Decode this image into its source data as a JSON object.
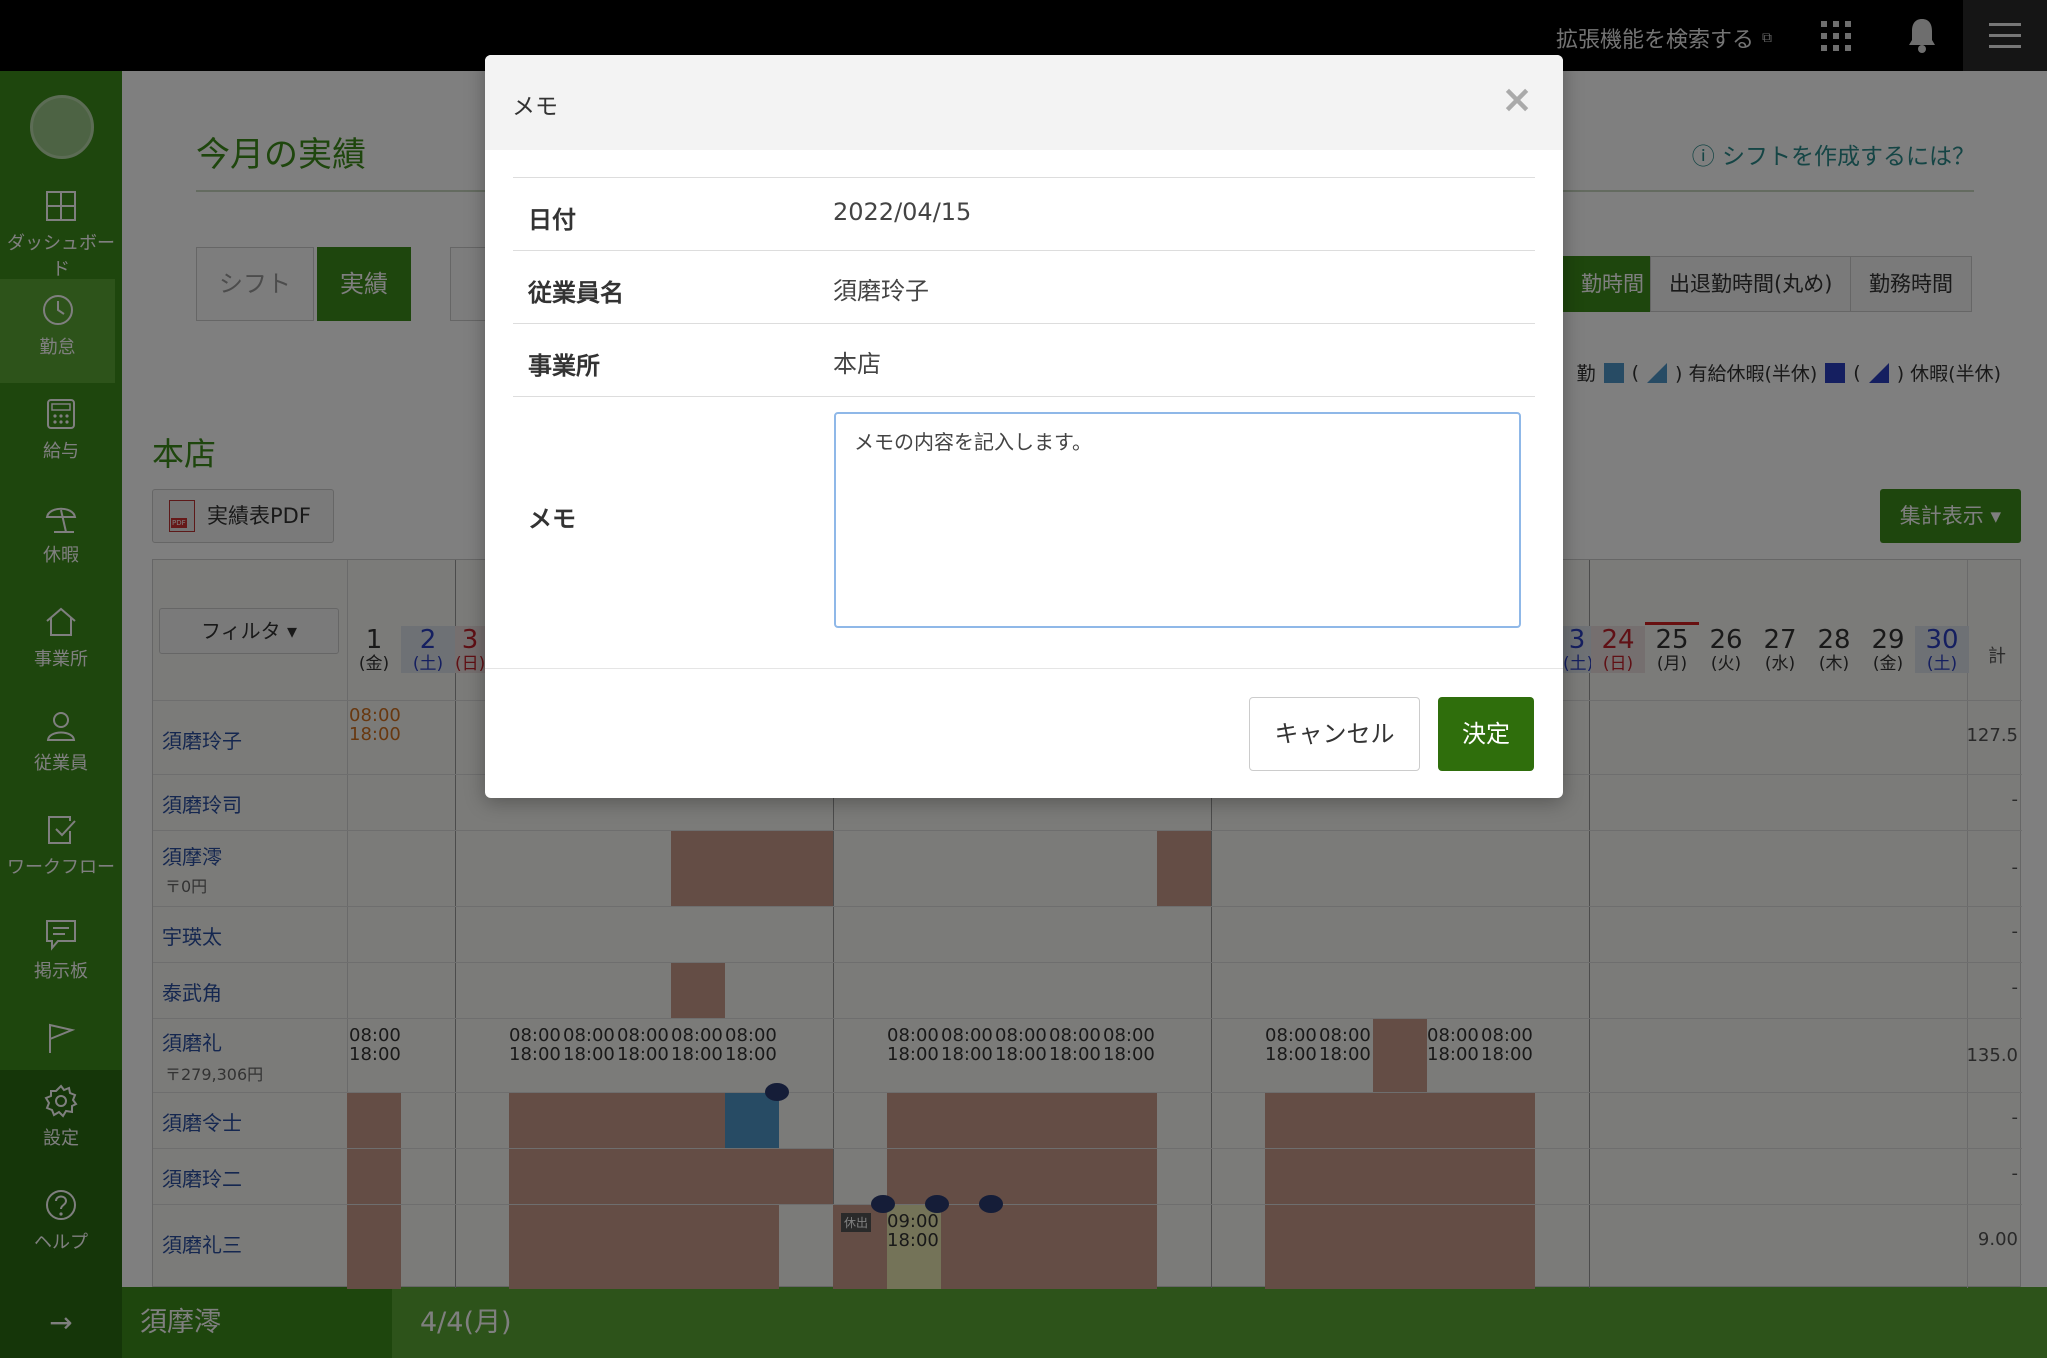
{
  "topbar": {
    "ext_search_label": "拡張機能を検索する",
    "ext_icon": "external-link-icon",
    "apps_icon": "apps-grid-icon",
    "bell_icon": "bell-icon",
    "menu_icon": "hamburger-icon"
  },
  "sidebar": {
    "items": [
      {
        "label": "ダッシュボード",
        "icon": "dashboard-icon"
      },
      {
        "label": "勤怠",
        "icon": "clock-icon"
      },
      {
        "label": "給与",
        "icon": "calculator-icon"
      },
      {
        "label": "休暇",
        "icon": "parasol-icon"
      },
      {
        "label": "事業所",
        "icon": "home-icon"
      },
      {
        "label": "従業員",
        "icon": "person-icon"
      },
      {
        "label": "ワークフロー",
        "icon": "workflow-icon"
      },
      {
        "label": "掲示板",
        "icon": "board-icon"
      },
      {
        "label": "",
        "icon": "flag-icon"
      },
      {
        "label": "設定",
        "icon": "gear-icon"
      },
      {
        "label": "ヘルプ",
        "icon": "help-icon"
      }
    ]
  },
  "bottombar": {
    "arrow": "→",
    "employee": "須摩澪",
    "date": "4/4(月)"
  },
  "main": {
    "title": "今月の実績",
    "help_link": "シフトを作成するには？",
    "tabs": [
      {
        "label": "シフト",
        "active": false
      },
      {
        "label": "実績",
        "active": true
      }
    ],
    "time_tabs": [
      {
        "label": "勤時間",
        "active": true
      },
      {
        "label": "出退勤時間(丸め)",
        "active": false
      },
      {
        "label": "勤務時間",
        "active": false
      }
    ],
    "legend": {
      "l0": "勤",
      "l1": "(",
      "l2": ") 有給休暇(半休)",
      "l3": "(",
      "l4": ") 休暇(半休)"
    },
    "store": "本店",
    "pdf_button": "実績表PDF",
    "agg_button": "集計表示 ▾",
    "filter_button": "フィルタ ▾",
    "total_header": "計",
    "days": [
      {
        "d": "1",
        "w": "(金)",
        "t": "w"
      },
      {
        "d": "2",
        "w": "(土)",
        "t": "sat"
      },
      {
        "d": "3",
        "w": "(日)",
        "t": "sun"
      },
      {
        "d": "3",
        "w": "(土)",
        "t": "sat"
      },
      {
        "d": "24",
        "w": "(日)",
        "t": "sun"
      },
      {
        "d": "25",
        "w": "(月)",
        "t": "w"
      },
      {
        "d": "26",
        "w": "(火)",
        "t": "w"
      },
      {
        "d": "27",
        "w": "(水)",
        "t": "w"
      },
      {
        "d": "28",
        "w": "(木)",
        "t": "w"
      },
      {
        "d": "29",
        "w": "(金)",
        "t": "w"
      },
      {
        "d": "30",
        "w": "(土)",
        "t": "sat"
      }
    ],
    "employees": [
      {
        "name": "須磨玲子",
        "sub": "",
        "total": "127.5"
      },
      {
        "name": "須磨玲司",
        "sub": "",
        "total": "-"
      },
      {
        "name": "須摩澪",
        "sub": "〒0円",
        "total": "-"
      },
      {
        "name": "宇瑛太",
        "sub": "",
        "total": "-"
      },
      {
        "name": "泰武角",
        "sub": "",
        "total": "-"
      },
      {
        "name": "須磨礼",
        "sub": "〒279,306円",
        "total": "135.0"
      },
      {
        "name": "須磨令士",
        "sub": "",
        "total": "-"
      },
      {
        "name": "須磨玲二",
        "sub": "",
        "total": "-"
      },
      {
        "name": "須磨礼三",
        "sub": "",
        "total": "9.00"
      }
    ],
    "times": {
      "start": "08:00",
      "end": "18:00",
      "start2": "09:00",
      "kyushutsu": "休出"
    }
  },
  "modal": {
    "title": "メモ",
    "close": "×",
    "fields": [
      {
        "label": "日付",
        "value": "2022/04/15"
      },
      {
        "label": "従業員名",
        "value": "須磨玲子"
      },
      {
        "label": "事業所",
        "value": "本店"
      }
    ],
    "memo_label": "メモ",
    "memo_value": "メモの内容を記入します。",
    "cancel": "キャンセル",
    "ok": "決定"
  },
  "colors": {
    "brand_green": "#3d8c1a",
    "dark_green": "#2b6c12",
    "off_cell": "#c89a8a",
    "paid_cell": "#4f97c9"
  }
}
